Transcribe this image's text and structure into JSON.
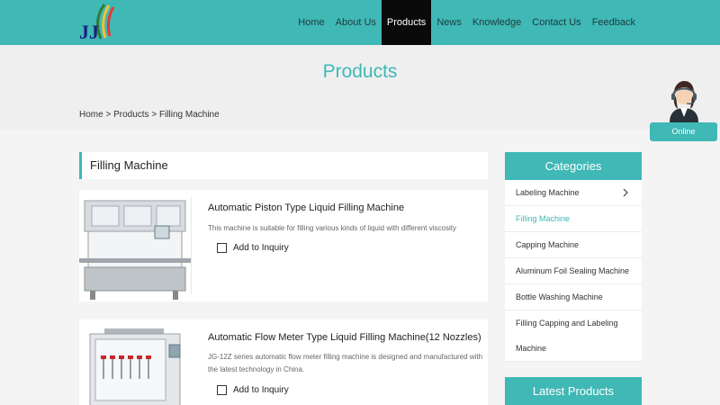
{
  "header": {
    "nav": [
      "Home",
      "About Us",
      "Products",
      "News",
      "Knowledge",
      "Contact Us",
      "Feedback"
    ],
    "active_nav": "Products"
  },
  "banner": {
    "title": "Products",
    "breadcrumb": [
      "Home",
      ">",
      "Products",
      ">",
      "Filling Machine"
    ]
  },
  "section": {
    "title": "Filling Machine"
  },
  "products": [
    {
      "title": "Automatic Piston Type Liquid Filling Machine",
      "desc": "This machine is suitable for filling various kinds of liquid with different viscosity",
      "inquiry_label": "Add to Inquiry"
    },
    {
      "title": "Automatic Flow Meter Type Liquid Filling Machine(12 Nozzles)",
      "desc": "JG-12Z series automatic flow meter filling machine is designed and manufactured with the latest technology in China.",
      "inquiry_label": "Add to Inquiry"
    }
  ],
  "sidebar": {
    "categories_title": "Categories",
    "categories": [
      "Labeling Machine",
      "Filling Machine",
      "Capping Machine",
      "Aluminum Foil Sealing Machine",
      "Bottle Washing Machine",
      "Filling Capping and Labeling Machine"
    ],
    "active_category": "Filling Machine",
    "latest_title": "Latest Products"
  },
  "online": {
    "label": "Online"
  },
  "colors": {
    "accent": "#3fb8b6",
    "nav_active_bg": "#0a0a0a"
  },
  "icons": [
    "logo-icon",
    "chevron-right-icon",
    "checkbox-icon",
    "support-agent-icon"
  ]
}
